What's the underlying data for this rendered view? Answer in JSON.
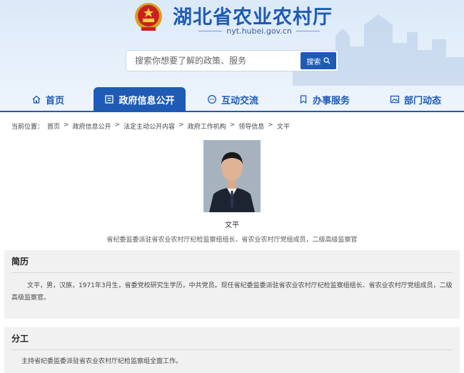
{
  "header": {
    "site_title": "湖北省农业农村厅",
    "domain": "nyt.hubei.gov.cn"
  },
  "search": {
    "placeholder": "搜索你想要了解的政策、服务",
    "button_label": "搜索"
  },
  "nav": {
    "items": [
      {
        "label": "首页",
        "icon": "home-icon"
      },
      {
        "label": "政府信息公开",
        "icon": "document-icon",
        "active": true
      },
      {
        "label": "互动交流",
        "icon": "chat-icon"
      },
      {
        "label": "办事服务",
        "icon": "bookmark-icon"
      },
      {
        "label": "部门动态",
        "icon": "image-icon"
      }
    ]
  },
  "breadcrumb": {
    "prefix": "当前位置：",
    "items": [
      "首页",
      "政府信息公开",
      "法定主动公开内容",
      "政府工作机构",
      "领导信息",
      "文平"
    ],
    "separator": ">"
  },
  "profile": {
    "name": "文平",
    "title": "省纪委监委派驻省农业农村厅纪检监察组组长、省农业农村厅党组成员，二级高级监察官"
  },
  "resume": {
    "heading": "简历",
    "text": "文平，男，汉族，1971年3月生，省委党校研究生学历，中共党员。现任省纪委监委派驻省农业农村厅纪检监察组组长、省农业农村厅党组成员，二级高级监察官。"
  },
  "duties": {
    "heading": "分工",
    "text": "主持省纪委监委派驻省农业农村厅纪检监察组全面工作。"
  },
  "colors": {
    "brand": "#1f5bb5",
    "header_bg": "#dbe9f8",
    "section_bg": "#f1f1f1"
  }
}
